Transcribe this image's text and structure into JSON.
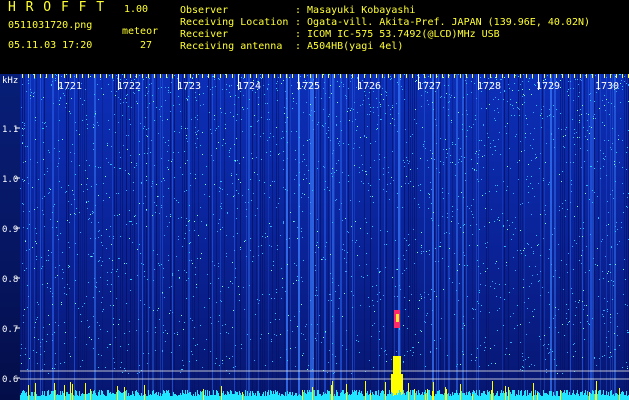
{
  "header": {
    "app_name": "H R O F F T",
    "version": "1.00",
    "filename": "0511031720.png",
    "datetime": "05.11.03 17:20",
    "meteor_label": "meteor",
    "meteor_count": "27",
    "info": [
      {
        "label": "Observer",
        "value": ": Masayuki Kobayashi"
      },
      {
        "label": "Receiving Location",
        "value": ": Ogata-vill. Akita-Pref. JAPAN (139.96E, 40.02N)"
      },
      {
        "label": "Receiver",
        "value": ": ICOM IC-575 53.7492(@LCD)MHz USB"
      },
      {
        "label": "Receiving antenna",
        "value": ": A504HB(yagi 4el)"
      }
    ]
  },
  "spectrogram": {
    "y_unit": "kHz",
    "y_ticks": [
      "1.1",
      "1.0",
      "0.9",
      "0.8",
      "0.7",
      "0.6"
    ],
    "time_labels": [
      "1721",
      "1722",
      "1723",
      "1724",
      "1725",
      "1726",
      "1727",
      "1728",
      "1729",
      "1730"
    ],
    "colors": {
      "bg": "#001a8c",
      "bright": "#22d4ff",
      "ticks": "#ffff33",
      "axis": "#ffffff"
    }
  }
}
